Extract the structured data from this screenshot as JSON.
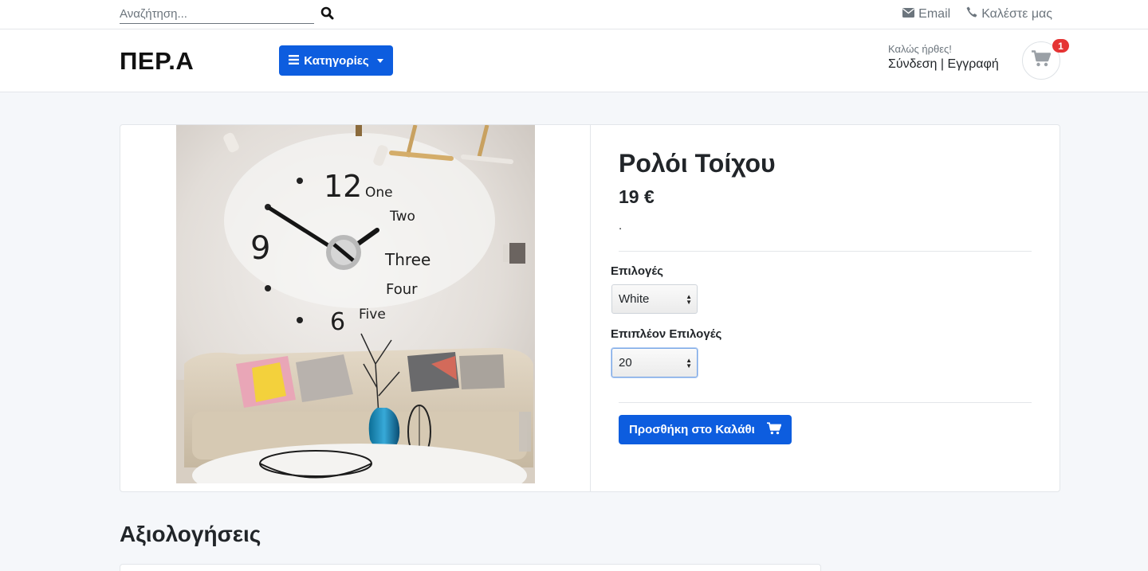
{
  "topbar": {
    "search_placeholder": "Αναζήτηση...",
    "email_label": "Email",
    "call_label": "Καλέστε μας"
  },
  "header": {
    "brand": "ΠΕΡ.Α",
    "categories_label": "Κατηγορίες",
    "welcome": "Καλώς ήρθες!",
    "login": "Σύνδεση",
    "separator": "|",
    "register": "Εγγραφή",
    "cart_count": "1"
  },
  "product": {
    "title": "Ρολόι Τοίχου",
    "price": "19 €",
    "description": ".",
    "options_label": "Επιλογές",
    "options_value": "White",
    "extra_options_label": "Επιπλέον Επιλογές",
    "extra_options_value": "20",
    "add_to_cart": "Προσθήκη στο Καλάθι",
    "image_clock_numbers": [
      "12",
      "One",
      "Two",
      "9",
      "Three",
      "Four",
      "6",
      "Five"
    ]
  },
  "reviews": {
    "title": "Αξιολογήσεις"
  },
  "colors": {
    "primary": "#0d5ddf",
    "badge": "#e53434"
  }
}
